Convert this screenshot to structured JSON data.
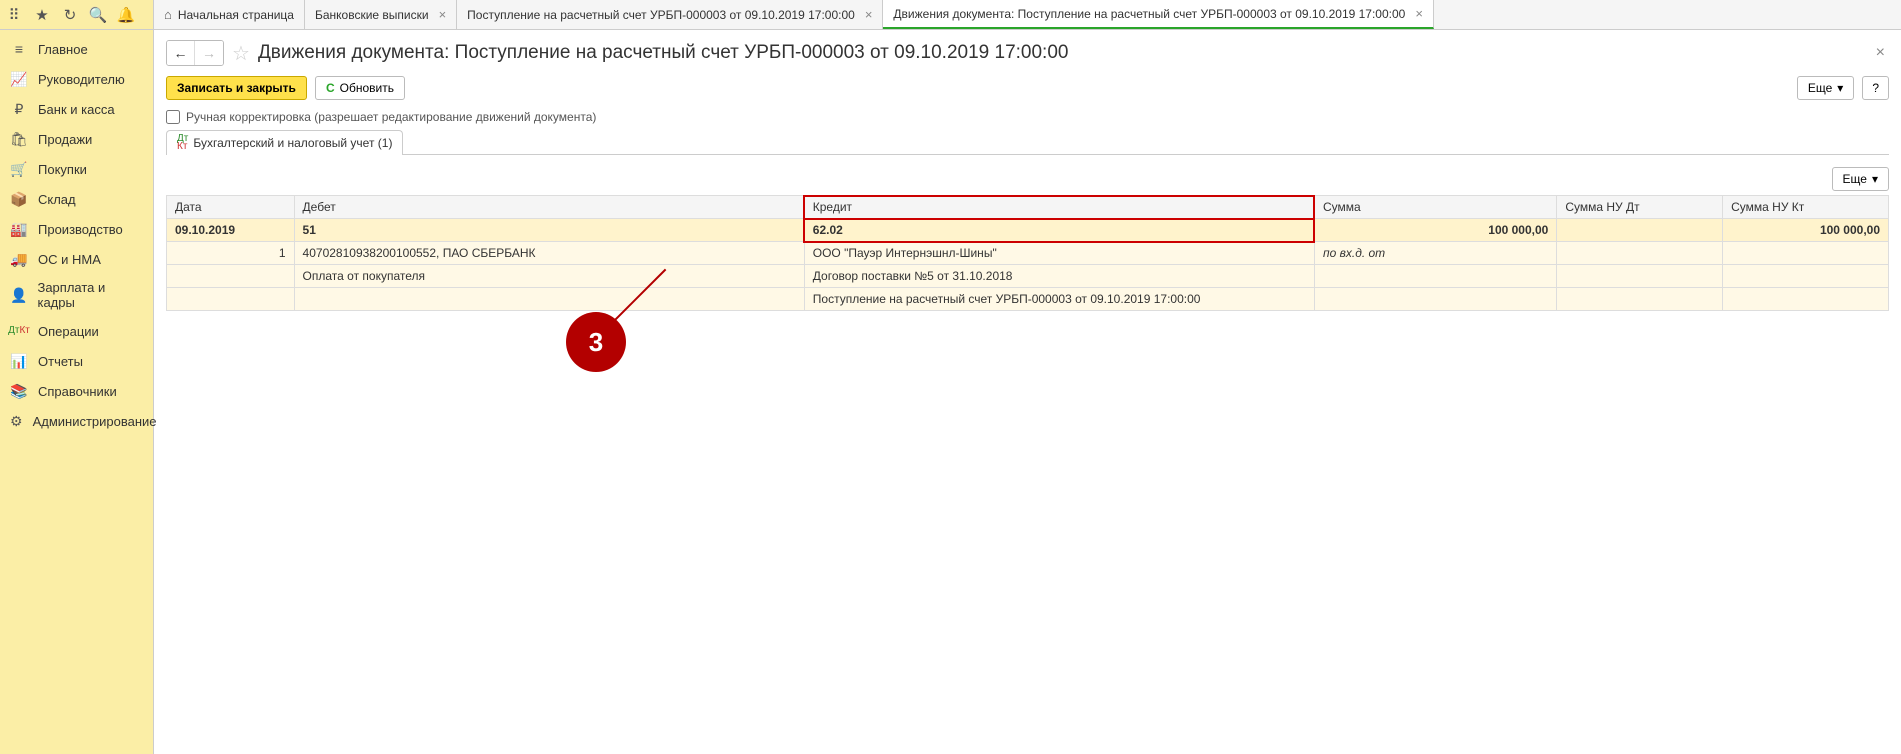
{
  "toolbar": {
    "icons": [
      "apps-icon",
      "star-icon",
      "history-icon",
      "search-icon",
      "bell-icon"
    ]
  },
  "tabs": {
    "home": "Начальная страница",
    "items": [
      {
        "label": "Банковские выписки"
      },
      {
        "label": "Поступление на расчетный счет УРБП-000003 от 09.10.2019 17:00:00"
      },
      {
        "label": "Движения документа: Поступление на расчетный счет УРБП-000003 от 09.10.2019 17:00:00",
        "active": true
      }
    ]
  },
  "sidebar": {
    "items": [
      {
        "icon": "star-icon",
        "label": "Главное"
      },
      {
        "icon": "chart-icon",
        "label": "Руководителю"
      },
      {
        "icon": "ruble-icon",
        "label": "Банк и касса"
      },
      {
        "icon": "bag-icon",
        "label": "Продажи"
      },
      {
        "icon": "cart-icon",
        "label": "Покупки"
      },
      {
        "icon": "warehouse-icon",
        "label": "Склад"
      },
      {
        "icon": "factory-icon",
        "label": "Производство"
      },
      {
        "icon": "truck-icon",
        "label": "ОС и НМА"
      },
      {
        "icon": "person-icon",
        "label": "Зарплата и кадры"
      },
      {
        "icon": "dtkt-icon",
        "label": "Операции"
      },
      {
        "icon": "bars-icon",
        "label": "Отчеты"
      },
      {
        "icon": "book-icon",
        "label": "Справочники"
      },
      {
        "icon": "gear-icon",
        "label": "Администрирование"
      }
    ]
  },
  "doc": {
    "title": "Движения документа: Поступление на расчетный счет УРБП-000003 от 09.10.2019 17:00:00",
    "save_close": "Записать и закрыть",
    "refresh": "Обновить",
    "more": "Еще",
    "help": "?",
    "manual_edit_label": "Ручная корректировка (разрешает редактирование движений документа)",
    "inner_tab": "Бухгалтерский и налоговый учет (1)",
    "table_more": "Еще"
  },
  "table": {
    "headers": {
      "date": "Дата",
      "debit": "Дебет",
      "credit": "Кредит",
      "sum": "Сумма",
      "sum_nu_dt": "Сумма НУ Дт",
      "sum_nu_kt": "Сумма НУ Кт"
    },
    "main": {
      "date": "09.10.2019",
      "debit": "51",
      "credit": "62.02",
      "sum": "100 000,00",
      "sum_nu_kt": "100 000,00"
    },
    "sub": {
      "rownum": "1",
      "debit_detail": "40702810938200100552, ПАО СБЕРБАНК",
      "credit_detail1": "ООО \"Пауэр Интернэшнл-Шины\"",
      "sum_note": "по вх.д.  от",
      "debit_detail2": "Оплата от покупателя",
      "credit_detail2": "Договор поставки №5 от 31.10.2018",
      "credit_detail3": "Поступление на расчетный счет УРБП-000003 от 09.10.2019 17:00:00"
    }
  },
  "annotation": {
    "number": "3"
  }
}
